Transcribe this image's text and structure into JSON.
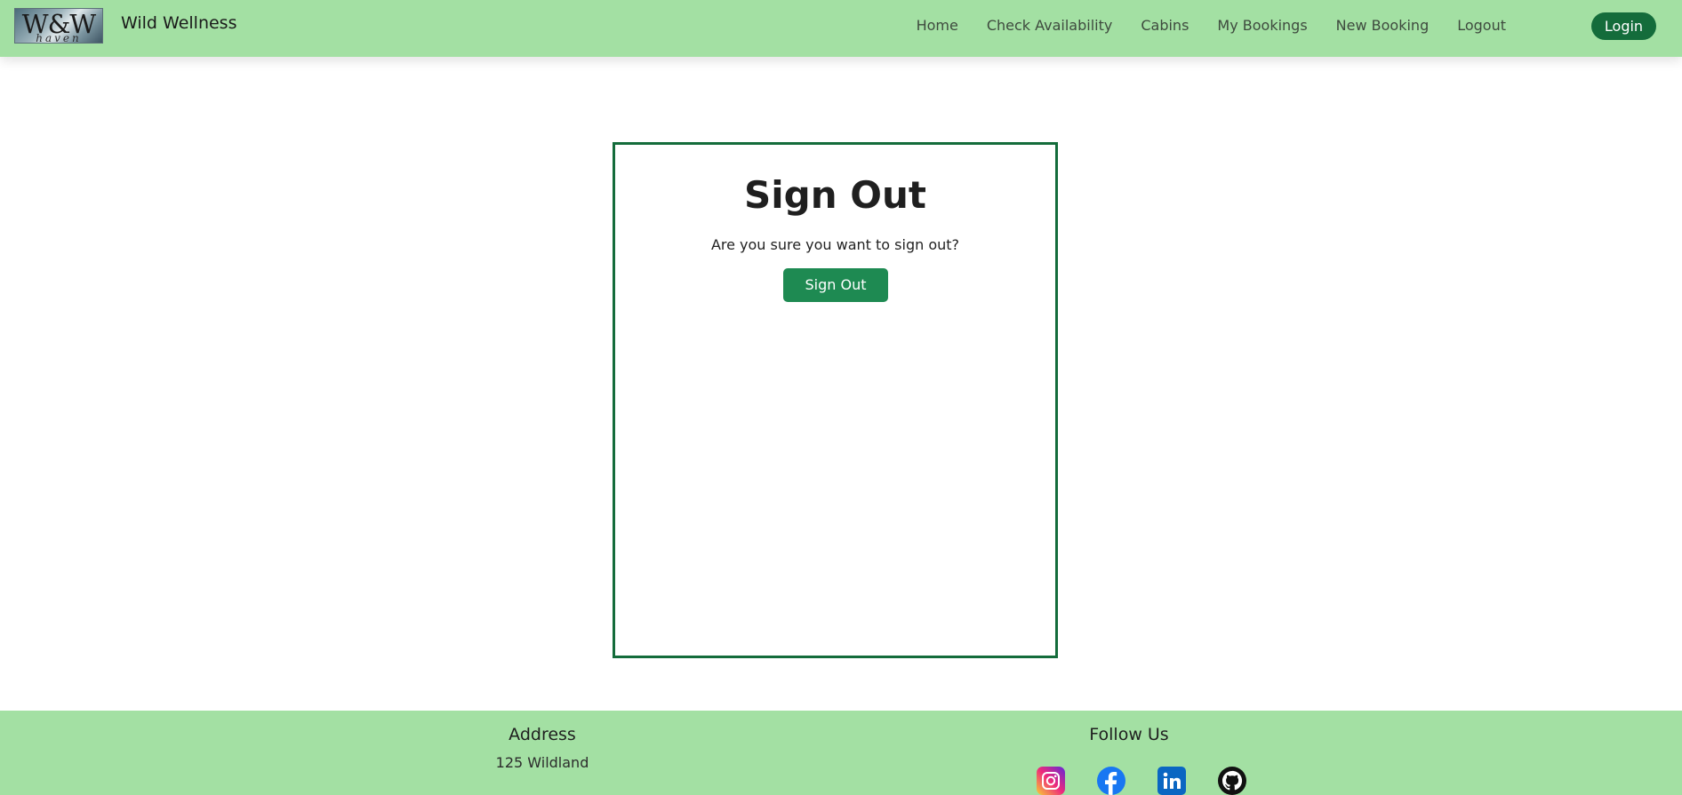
{
  "navbar": {
    "logo_text": "W&W",
    "logo_sub": "haven",
    "brand": "Wild Wellness",
    "links": [
      "Home",
      "Check Availability",
      "Cabins",
      "My Bookings",
      "New Booking",
      "Logout"
    ],
    "login_label": "Login"
  },
  "card": {
    "title": "Sign Out",
    "text": "Are you sure you want to sign out?",
    "button_label": "Sign Out"
  },
  "footer": {
    "address_heading": "Address",
    "address_text": "125 Wildland",
    "follow_heading": "Follow Us",
    "socials": [
      "instagram-icon",
      "facebook-icon",
      "linkedin-icon",
      "github-icon"
    ]
  },
  "colors": {
    "nav_bg": "#a3e0a3",
    "accent": "#146c3b",
    "button": "#1e8a52"
  }
}
